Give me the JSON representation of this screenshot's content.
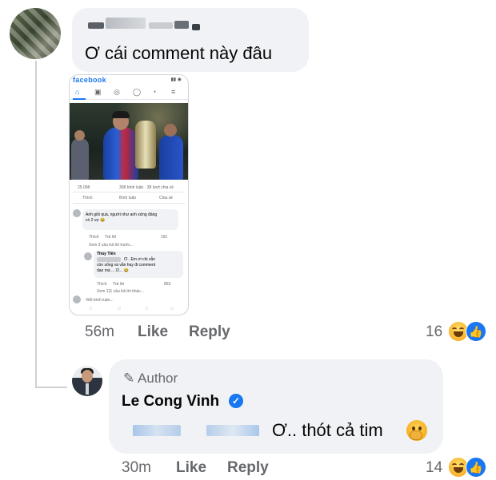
{
  "comment1": {
    "text": "Ơ cái comment này đâu",
    "time": "56m",
    "like_label": "Like",
    "reply_label": "Reply",
    "reaction_count": "16"
  },
  "embedded_screenshot": {
    "logo": "facebook",
    "nav_icons": [
      "home-icon",
      "video-icon",
      "groups-icon",
      "profile-icon",
      "notifications-icon",
      "menu-icon"
    ],
    "reactions_count": "25.098",
    "post_stats": "308 bình luận · 38 lượt chia sẻ",
    "actions": [
      "Thích",
      "Bình luận",
      "Chia sẻ"
    ],
    "comment_a": {
      "text_line1": "Anh giỏi quá, người như anh xứng đáng",
      "text_line2": "có 2 vợ 😂",
      "like": "Thích",
      "reply": "Trả lời",
      "count": "191",
      "more": "Xem 3 câu trả lời trước..."
    },
    "reply_a": {
      "name": "Thùy Tiên",
      "text_line1": "Ơ.. Em ơi chị vẫn",
      "text_line2": "còn sống và vẫn hay đi comment",
      "text_line3": "dạo mà ... Ơ... 😂",
      "like": "Thích",
      "reply": "Trả lời",
      "count": "853",
      "more": "Xem 111 câu trả lời khác..."
    },
    "write_reply": "Viết bình luận..."
  },
  "comment2": {
    "author_badge": "Author",
    "author_name": "Le Cong Vinh",
    "text": "Ơ.. thót cả tim",
    "time": "30m",
    "like_label": "Like",
    "reply_label": "Reply",
    "reaction_count": "14"
  },
  "colors": {
    "facebook_blue": "#1877f2",
    "bubble_bg": "#f0f2f5",
    "secondary_text": "#65676b"
  }
}
